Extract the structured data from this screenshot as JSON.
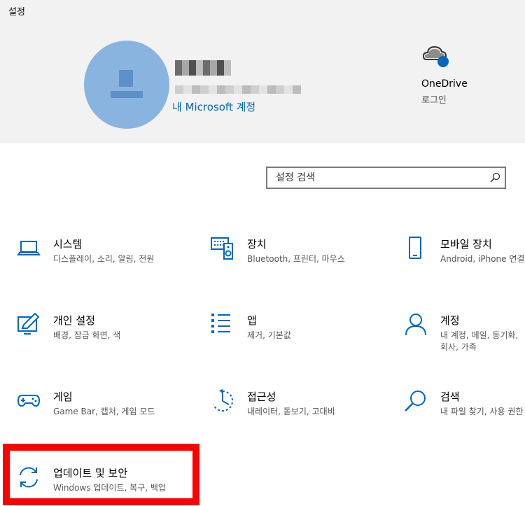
{
  "window": {
    "title": "설정"
  },
  "account": {
    "link": "내 Microsoft 계정"
  },
  "onedrive": {
    "title": "OneDrive",
    "subtitle": "로그인"
  },
  "search": {
    "placeholder": "설정 검색"
  },
  "tiles": [
    {
      "id": "system",
      "title": "시스템",
      "desc": "디스플레이, 소리, 알림, 전원",
      "icon": "laptop-icon"
    },
    {
      "id": "devices",
      "title": "장치",
      "desc": "Bluetooth, 프린터, 마우스",
      "icon": "keyboard-speaker-icon"
    },
    {
      "id": "phone",
      "title": "모바일 장치",
      "desc": "Android, iPhone 연결",
      "icon": "phone-icon"
    },
    {
      "id": "personalization",
      "title": "개인 설정",
      "desc": "배경, 잠금 화면, 색",
      "icon": "paint-icon"
    },
    {
      "id": "apps",
      "title": "앱",
      "desc": "제거, 기본값",
      "icon": "list-icon"
    },
    {
      "id": "accounts",
      "title": "계정",
      "desc": "내 계정, 메일, 동기화, 회사, 가족",
      "icon": "person-icon"
    },
    {
      "id": "gaming",
      "title": "게임",
      "desc": "Game Bar, 캡처, 게임 모드",
      "icon": "gamepad-icon"
    },
    {
      "id": "ease",
      "title": "접근성",
      "desc": "내레이터, 돋보기, 고대비",
      "icon": "ease-of-access-icon"
    },
    {
      "id": "search",
      "title": "검색",
      "desc": "내 파일 찾기, 사용 권한",
      "icon": "magnifier-icon"
    },
    {
      "id": "update",
      "title": "업데이트 및 보안",
      "desc": "Windows 업데이트, 복구, 백업",
      "icon": "sync-icon"
    }
  ],
  "colors": {
    "accent": "#0067c0",
    "highlight": "#ff0000",
    "header_bg": "#f2f2f2"
  }
}
